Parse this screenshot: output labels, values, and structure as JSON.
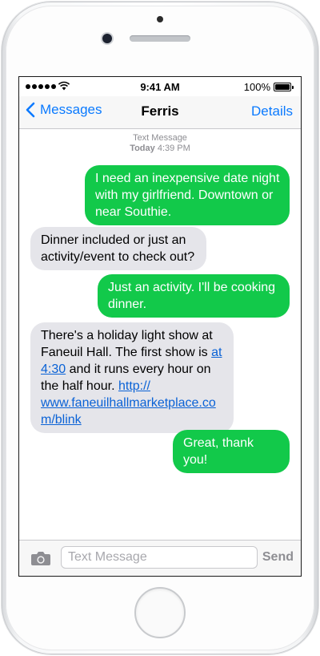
{
  "status_bar": {
    "time": "9:41 AM",
    "battery": "100%"
  },
  "nav": {
    "back_label": "Messages",
    "title": "Ferris",
    "details_label": "Details"
  },
  "thread": {
    "stamp_type": "Text Message",
    "stamp_day": "Today",
    "stamp_time": "4:39 PM",
    "messages": [
      {
        "direction": "outgoing",
        "lines": [
          "I need an inexpensive date night",
          "with my girlfriend. Downtown or",
          "near Southie."
        ]
      },
      {
        "direction": "incoming",
        "lines": [
          "Dinner included or just an",
          "activity/event to check out?"
        ]
      },
      {
        "direction": "outgoing",
        "lines": [
          "Just an activity. I'll be cooking",
          "dinner."
        ]
      },
      {
        "direction": "incoming",
        "line1": "There's a holiday light show at",
        "line2_pre": "Faneuil Hall. The first show is ",
        "line2_link": "at",
        "line3_link": "4:30",
        "line3_post": " and it runs every hour on",
        "line4_pre": "the half hour. ",
        "line4_link": "http://",
        "line5_link": "www.faneuilhallmarketplace.co",
        "line6_link": "m/blink"
      },
      {
        "direction": "outgoing",
        "lines": [
          "Great, thank you!"
        ]
      }
    ]
  },
  "composer": {
    "placeholder": "Text Message",
    "send_label": "Send"
  },
  "colors": {
    "outgoing_bubble": "#12c94a",
    "incoming_bubble": "#e5e5ea",
    "ios_blue": "#0a7aff"
  }
}
